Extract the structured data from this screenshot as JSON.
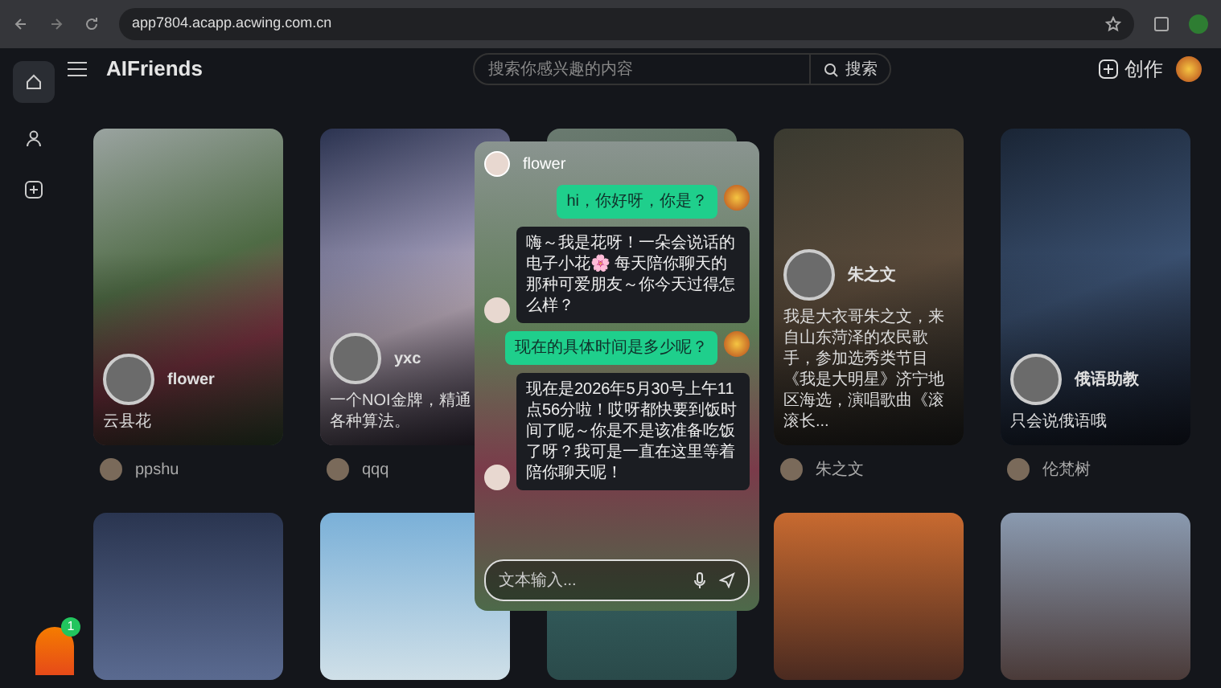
{
  "browser": {
    "url": "app7804.acapp.acwing.com.cn"
  },
  "header": {
    "title": "AIFriends",
    "search_placeholder": "搜索你感兴趣的内容",
    "search_button": "搜索",
    "create_button": "创作"
  },
  "sidebar": {
    "items": [
      {
        "kind": "home",
        "selected": true
      },
      {
        "kind": "user",
        "selected": false
      },
      {
        "kind": "create",
        "selected": false
      }
    ]
  },
  "cards": [
    {
      "kind": "profile",
      "name": "flower",
      "description": "云县花",
      "author": "ppshu"
    },
    {
      "kind": "profile",
      "name": "yxc",
      "description": "一个NOI金牌，精通各种算法。",
      "author": "qqq"
    },
    {
      "kind": "covered"
    },
    {
      "kind": "profile",
      "name": "朱之文",
      "description": "我是大衣哥朱之文，来自山东菏泽的农民歌手，参加选秀类节目《我是大明星》济宁地区海选，演唱歌曲《滚滚长...",
      "author": "朱之文"
    },
    {
      "kind": "profile",
      "name": "俄语助教",
      "description": "只会说俄语哦",
      "author": "伦梵树"
    },
    {
      "kind": "image"
    },
    {
      "kind": "image"
    },
    {
      "kind": "image"
    },
    {
      "kind": "image"
    },
    {
      "kind": "image"
    }
  ],
  "chat": {
    "title": "flower",
    "messages": [
      {
        "kind": "user",
        "text": "hi，你好呀，你是？"
      },
      {
        "kind": "bot",
        "text": "嗨～我是花呀！一朵会说话的电子小花🌸 每天陪你聊天的那种可爱朋友～你今天过得怎么样？"
      },
      {
        "kind": "user",
        "text": "现在的具体时间是多少呢？"
      },
      {
        "kind": "bot",
        "text": "现在是2026年5月30号上午11点56分啦！哎呀都快要到饭时间了呢～你是不是该准备吃饭了呀？我可是一直在这里等着陪你聊天呢！"
      }
    ],
    "input_placeholder": "文本输入..."
  },
  "mascot": {
    "badge": "1"
  }
}
